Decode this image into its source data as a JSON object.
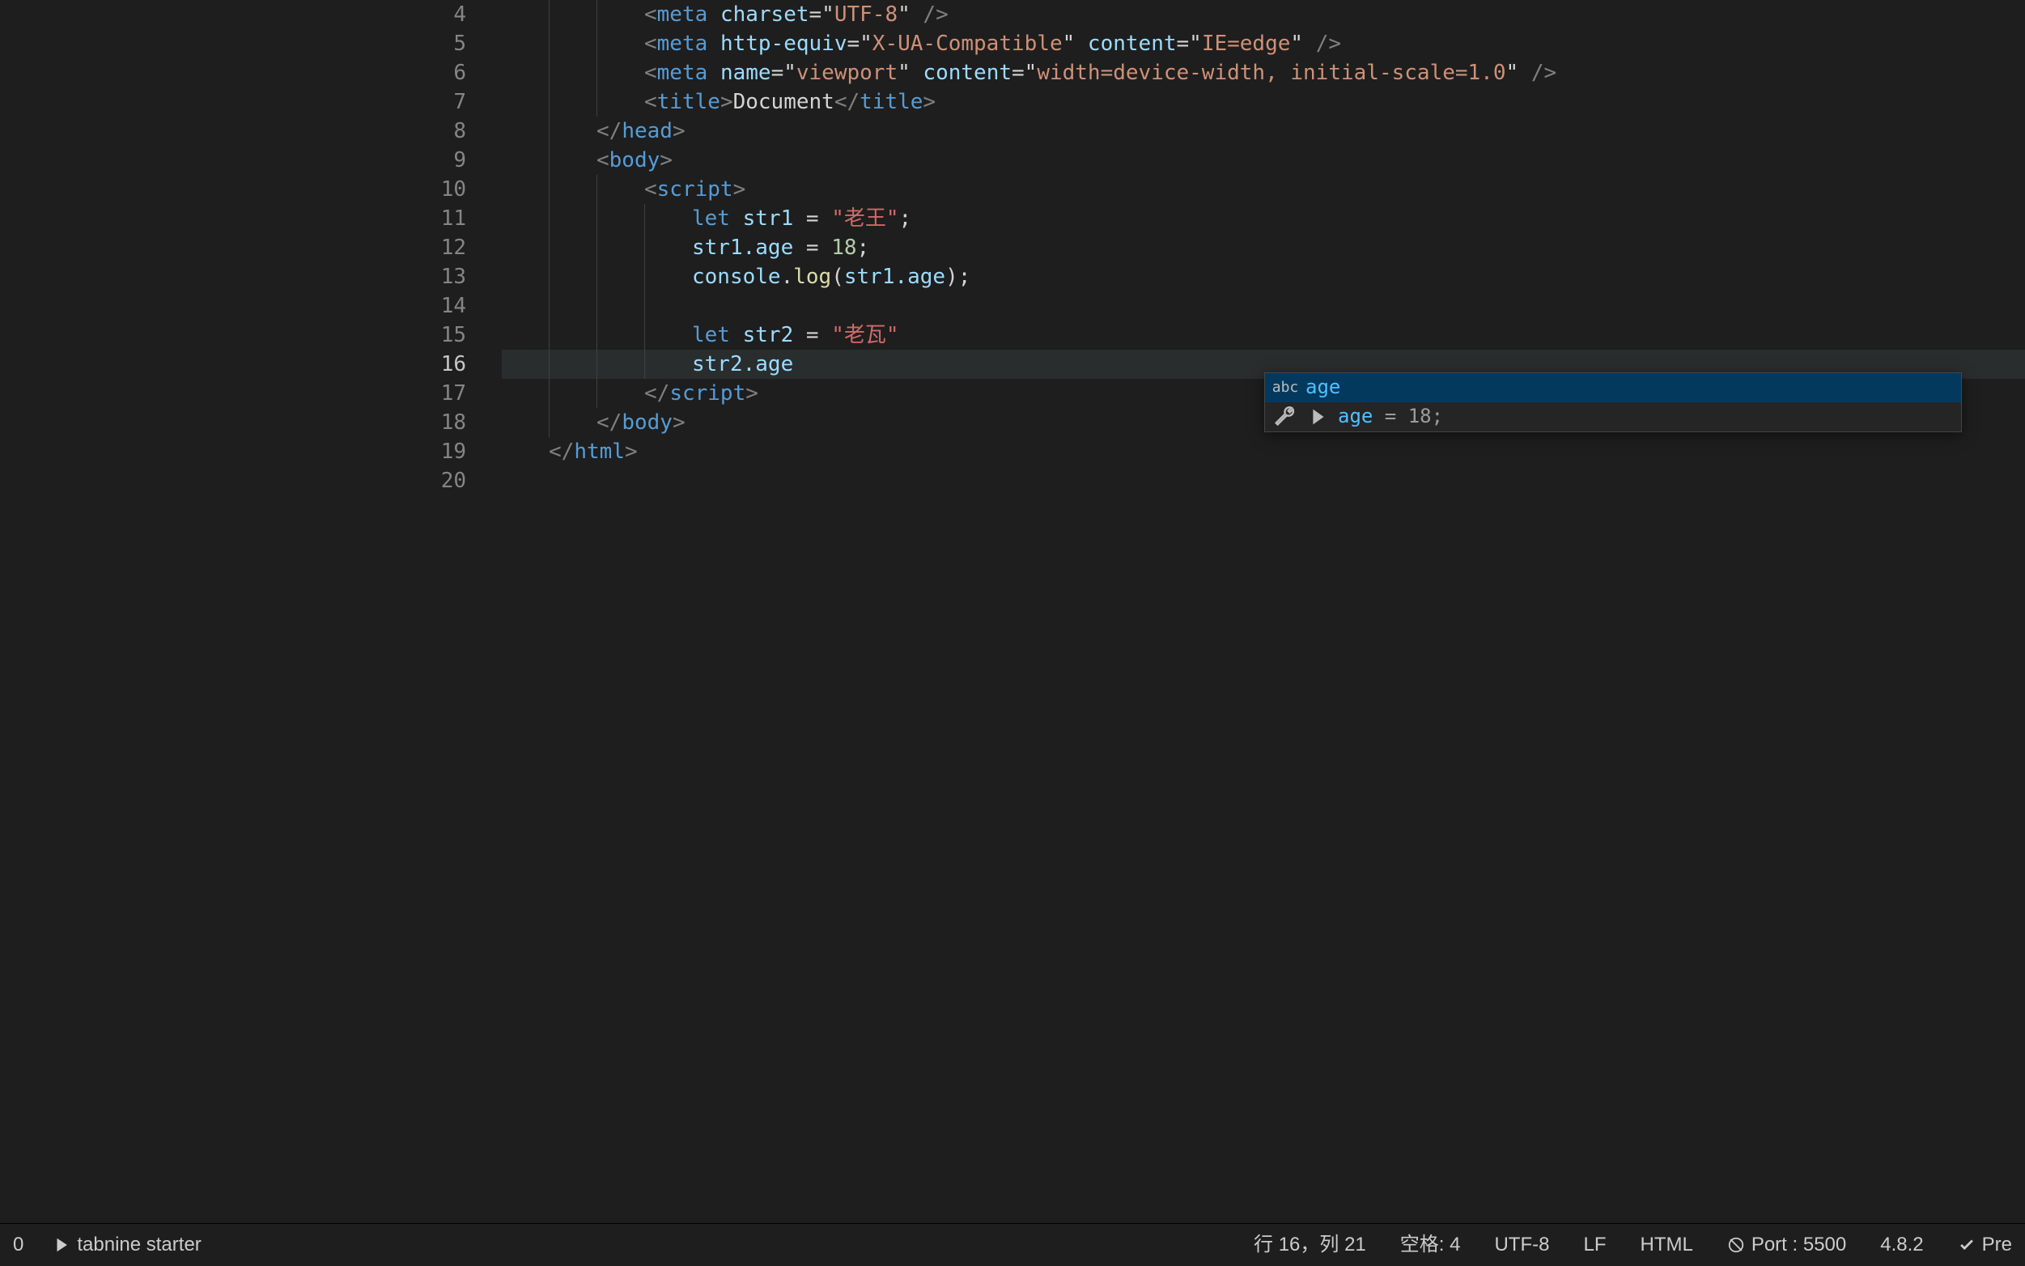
{
  "gutter": {
    "start": 4,
    "end": 20,
    "active": 16
  },
  "code": {
    "l4": {
      "tag": "meta",
      "attr": "charset",
      "val": "UTF-8"
    },
    "l5": {
      "tag": "meta",
      "attr1": "http-equiv",
      "val1": "X-UA-Compatible",
      "attr2": "content",
      "val2": "IE=edge"
    },
    "l6": {
      "tag": "meta",
      "attr1": "name",
      "val1": "viewport",
      "attr2": "content",
      "val2": "width=device-width, initial-scale=1.0"
    },
    "l7": {
      "open": "title",
      "text": "Document",
      "close": "title"
    },
    "l8": {
      "close": "head"
    },
    "l9": {
      "open": "body"
    },
    "l10": {
      "open": "script"
    },
    "l11": {
      "kw": "let",
      "id": "str1",
      "eq": "=",
      "str": "\"老王\"",
      "semi": ";"
    },
    "l12": {
      "lhs": "str1.age",
      "eq": "=",
      "num": "18",
      "semi": ";"
    },
    "l13": {
      "obj": "console",
      "dot": ".",
      "fn": "log",
      "open": "(",
      "arg": "str1.age",
      "close": ")",
      "semi": ";"
    },
    "l15": {
      "kw": "let",
      "id": "str2",
      "eq": "=",
      "str": "\"老瓦\""
    },
    "l16": {
      "txt": "str2.age"
    },
    "l17": {
      "close": "script"
    },
    "l18": {
      "close": "body"
    },
    "l19": {
      "close": "html"
    }
  },
  "suggest": {
    "items": [
      {
        "kind": "abc",
        "label": "age"
      },
      {
        "kind": "wrench",
        "label": "age",
        "extra": " = 18;"
      }
    ]
  },
  "status": {
    "left_zero": "0",
    "tabnine": "tabnine starter",
    "ln_col": "行 16，列 21",
    "spaces": "空格: 4",
    "encoding": "UTF-8",
    "eol": "LF",
    "lang": "HTML",
    "port": "Port : 5500",
    "version": "4.8.2",
    "prettier": "Pre"
  }
}
